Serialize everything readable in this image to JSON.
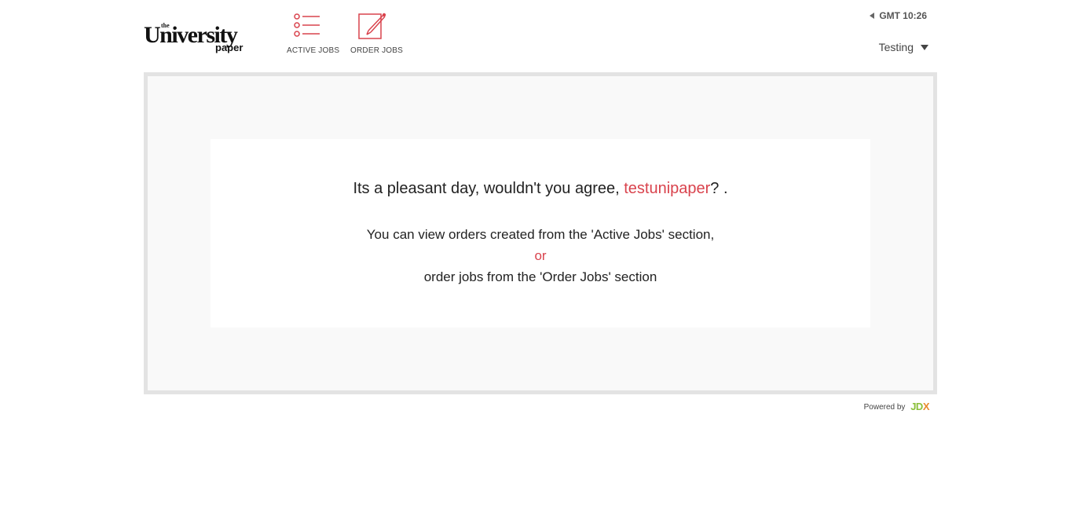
{
  "brand": {
    "the": "the",
    "name": "University",
    "sub": "paper"
  },
  "nav": {
    "active_jobs": {
      "label": "ACTIVE JOBS",
      "icon": "list-icon"
    },
    "order_jobs": {
      "label": "ORDER JOBS",
      "icon": "edit-icon"
    }
  },
  "header": {
    "time": "GMT 10:26",
    "user_name": "Testing"
  },
  "welcome": {
    "greeting_prefix": "Its a pleasant day, wouldn't you agree, ",
    "username": "testunipaper",
    "greeting_suffix": "? .",
    "line1": "You can view orders created from the 'Active Jobs' section,",
    "or": "or",
    "line2": "order jobs from the 'Order Jobs' section"
  },
  "footer": {
    "powered_by": "Powered by",
    "brand_jd": "JD",
    "brand_x": "X"
  },
  "colors": {
    "accent": "#d9434d",
    "frame_border": "#e3e3e3",
    "frame_bg": "#f9f9f9",
    "jdx_green": "#8bbf3a",
    "jdx_orange": "#e98a2c"
  }
}
